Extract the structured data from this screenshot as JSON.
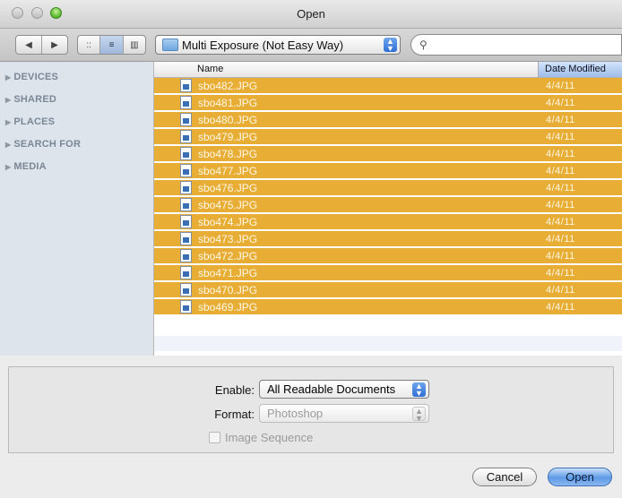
{
  "window": {
    "title": "Open"
  },
  "toolbar": {
    "back_icon": "◀",
    "forward_icon": "▶",
    "view_icons": [
      "::",
      "≡",
      "▥"
    ],
    "location": "Multi Exposure (Not Easy Way)",
    "search_placeholder": "",
    "search_icon": "⚲"
  },
  "sidebar": {
    "items": [
      {
        "label": "DEVICES"
      },
      {
        "label": "SHARED"
      },
      {
        "label": "PLACES"
      },
      {
        "label": "SEARCH FOR"
      },
      {
        "label": "MEDIA"
      }
    ]
  },
  "file_list": {
    "columns": {
      "name": "Name",
      "date": "Date Modified"
    },
    "rows": [
      {
        "name": "sbo482.JPG",
        "date": "4/4/11"
      },
      {
        "name": "sbo481.JPG",
        "date": "4/4/11"
      },
      {
        "name": "sbo480.JPG",
        "date": "4/4/11"
      },
      {
        "name": "sbo479.JPG",
        "date": "4/4/11"
      },
      {
        "name": "sbo478.JPG",
        "date": "4/4/11"
      },
      {
        "name": "sbo477.JPG",
        "date": "4/4/11"
      },
      {
        "name": "sbo476.JPG",
        "date": "4/4/11"
      },
      {
        "name": "sbo475.JPG",
        "date": "4/4/11"
      },
      {
        "name": "sbo474.JPG",
        "date": "4/4/11"
      },
      {
        "name": "sbo473.JPG",
        "date": "4/4/11"
      },
      {
        "name": "sbo472.JPG",
        "date": "4/4/11"
      },
      {
        "name": "sbo471.JPG",
        "date": "4/4/11"
      },
      {
        "name": "sbo470.JPG",
        "date": "4/4/11"
      },
      {
        "name": "sbo469.JPG",
        "date": "4/4/11"
      }
    ],
    "selection_color": "#e7ad35"
  },
  "options": {
    "enable_label": "Enable:",
    "enable_value": "All Readable Documents",
    "format_label": "Format:",
    "format_value": "Photoshop",
    "sequence_label": "Image Sequence"
  },
  "buttons": {
    "cancel": "Cancel",
    "open": "Open"
  },
  "colors": {
    "accent": "#5f9be7",
    "sidebar": "#dde4ec"
  }
}
